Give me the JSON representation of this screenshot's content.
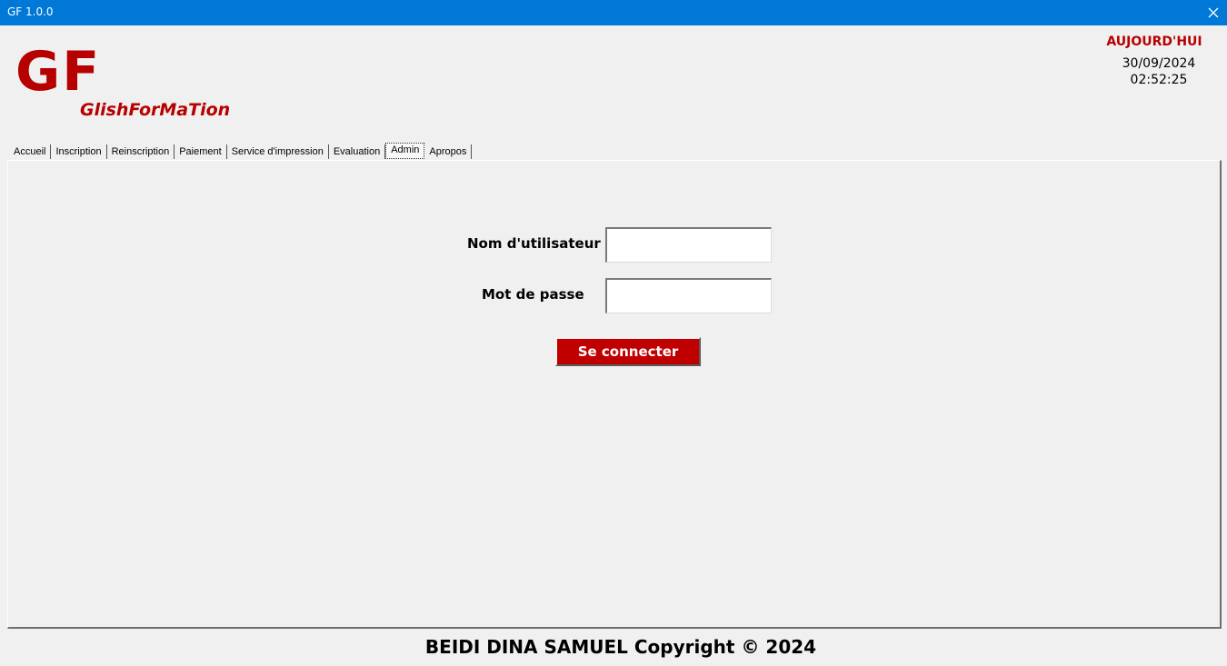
{
  "window": {
    "title": "GF 1.0.0",
    "close_icon": "close-icon"
  },
  "brand": {
    "logo": "GF",
    "subtitle": "GlishForMaTion",
    "color": "#b70000"
  },
  "today": {
    "label": "AUJOURD'HUI",
    "date": "30/09/2024",
    "time": "02:52:25"
  },
  "tabs": [
    {
      "label": "Accueil",
      "active": false
    },
    {
      "label": "Inscription",
      "active": false
    },
    {
      "label": "Reinscription",
      "active": false
    },
    {
      "label": "Paiement",
      "active": false
    },
    {
      "label": "Service d'impression",
      "active": false
    },
    {
      "label": "Evaluation",
      "active": false
    },
    {
      "label": "Admin",
      "active": true
    },
    {
      "label": "Apropos",
      "active": false
    }
  ],
  "login": {
    "username_label": "Nom d'utilisateur",
    "username_value": "",
    "password_label": "Mot de passe",
    "password_value": "",
    "submit_label": "Se connecter",
    "button_color": "#c00000"
  },
  "footer": {
    "text": "BEIDI DINA SAMUEL Copyright © 2024"
  }
}
